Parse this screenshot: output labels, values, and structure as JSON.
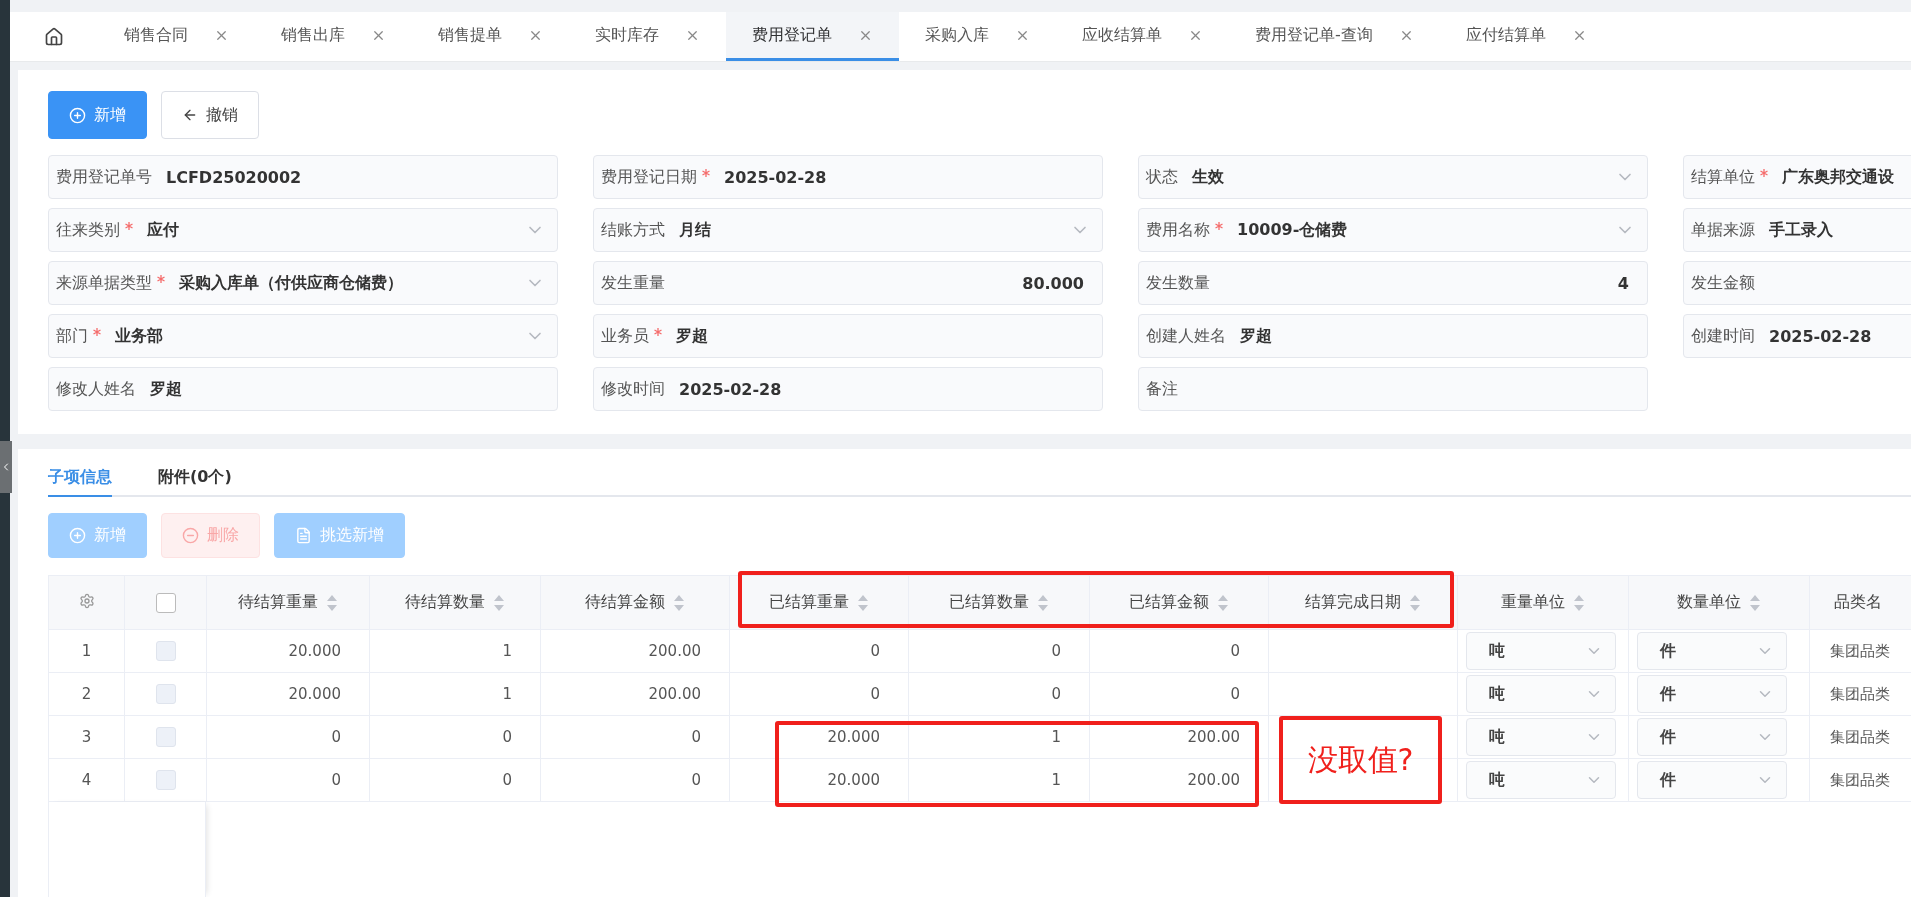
{
  "tabs": [
    {
      "kind": "home",
      "selected": false
    },
    {
      "kind": "page",
      "label": "销售合同",
      "selected": false
    },
    {
      "kind": "page",
      "label": "销售出库",
      "selected": false
    },
    {
      "kind": "page",
      "label": "销售提单",
      "selected": false
    },
    {
      "kind": "page",
      "label": "实时库存",
      "selected": false
    },
    {
      "kind": "page",
      "label": "费用登记单",
      "selected": true
    },
    {
      "kind": "page",
      "label": "采购入库",
      "selected": false
    },
    {
      "kind": "page",
      "label": "应收结算单",
      "selected": false
    },
    {
      "kind": "page",
      "label": "费用登记单-查询",
      "selected": false
    },
    {
      "kind": "page",
      "label": "应付结算单",
      "selected": false
    }
  ],
  "toolbar": [
    {
      "kind": "primary",
      "label": "新增"
    },
    {
      "kind": "default",
      "label": "撤销"
    }
  ],
  "form": {
    "fields": [
      {
        "label": "费用登记单号",
        "required": false,
        "kind": "text",
        "value": "LCFD25020002"
      },
      {
        "label": "费用登记日期",
        "required": true,
        "kind": "text",
        "value": "2025-02-28"
      },
      {
        "label": "状态",
        "required": false,
        "kind": "select",
        "value": "生效"
      },
      {
        "label": "结算单位",
        "required": true,
        "kind": "text",
        "value": "广东奥邦交通设"
      },
      {
        "label": "往来类别",
        "required": true,
        "kind": "select",
        "value": "应付"
      },
      {
        "label": "结账方式",
        "required": false,
        "kind": "select",
        "value": "月结"
      },
      {
        "label": "费用名称",
        "required": true,
        "kind": "select",
        "value": "10009-仓储费"
      },
      {
        "label": "单据来源",
        "required": false,
        "kind": "text",
        "value": "手工录入"
      },
      {
        "label": "来源单据类型",
        "required": true,
        "kind": "select",
        "value": "采购入库单（付供应商仓储费）"
      },
      {
        "label": "发生重量",
        "required": false,
        "kind": "number",
        "value": "80.000"
      },
      {
        "label": "发生数量",
        "required": false,
        "kind": "number",
        "value": "4"
      },
      {
        "label": "发生金额",
        "required": false,
        "kind": "number"
      },
      {
        "label": "部门",
        "required": true,
        "kind": "select",
        "value": "业务部"
      },
      {
        "label": "业务员",
        "required": true,
        "kind": "text",
        "value": "罗超"
      },
      {
        "label": "创建人姓名",
        "required": false,
        "kind": "text",
        "value": "罗超"
      },
      {
        "label": "创建时间",
        "required": false,
        "kind": "text",
        "value": "2025-02-28"
      },
      {
        "label": "修改人姓名",
        "required": false,
        "kind": "text",
        "value": "罗超"
      },
      {
        "label": "修改时间",
        "required": false,
        "kind": "text",
        "value": "2025-02-28"
      },
      {
        "label": "备注",
        "required": false,
        "kind": "text"
      }
    ]
  },
  "sub_tabs": [
    {
      "label": "子项信息",
      "selected": true
    },
    {
      "label": "附件(0个)",
      "selected": false
    }
  ],
  "actions": [
    {
      "kind": "primary",
      "label": "新增",
      "disabled": true
    },
    {
      "kind": "danger",
      "label": "删除",
      "disabled": true
    },
    {
      "kind": "primary",
      "label": "挑选新增",
      "disabled": true
    }
  ],
  "table": {
    "header_checked": false,
    "columns": [
      "待结算重量",
      "待结算数量",
      "待结算金额",
      "已结算重量",
      "已结算数量",
      "已结算金额",
      "结算完成日期",
      "重量单位",
      "数量单位",
      "品类名"
    ],
    "rows": [
      {
        "index": "1",
        "checked": false,
        "cells": [
          "20.000",
          "1",
          "200.00",
          "0",
          "0",
          "0",
          ""
        ],
        "weight_unit": "吨",
        "qty_unit": "件",
        "category": "集团品类"
      },
      {
        "index": "2",
        "checked": false,
        "cells": [
          "20.000",
          "1",
          "200.00",
          "0",
          "0",
          "0",
          ""
        ],
        "weight_unit": "吨",
        "qty_unit": "件",
        "category": "集团品类"
      },
      {
        "index": "3",
        "checked": false,
        "cells": [
          "0",
          "0",
          "0",
          "20.000",
          "1",
          "200.00",
          ""
        ],
        "weight_unit": "吨",
        "qty_unit": "件",
        "category": "集团品类"
      },
      {
        "index": "4",
        "checked": false,
        "cells": [
          "0",
          "0",
          "0",
          "20.000",
          "1",
          "200.00",
          ""
        ],
        "weight_unit": "吨",
        "qty_unit": "件",
        "category": "集团品类"
      }
    ]
  },
  "annotations": [
    {
      "kind": "box"
    },
    {
      "kind": "box"
    },
    {
      "kind": "note",
      "text": "没取值?"
    }
  ]
}
